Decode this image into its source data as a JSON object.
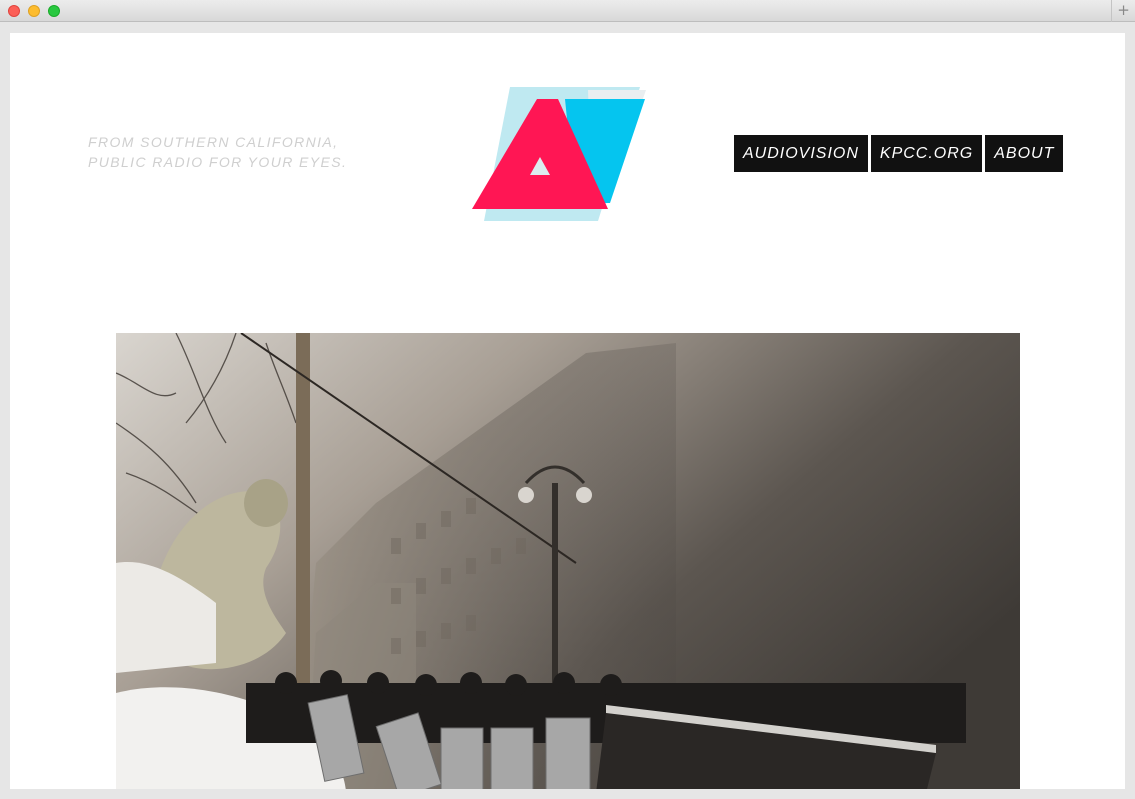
{
  "window": {
    "controls": [
      "close",
      "minimize",
      "zoom"
    ],
    "new_tab_label": "+"
  },
  "site": {
    "tagline": {
      "line1": "FROM SOUTHERN CALIFORNIA,",
      "line2": "PUBLIC RADIO FOR YOUR EYES."
    },
    "logo": {
      "letters": "AV",
      "colors": {
        "magenta": "#ff1654",
        "cyan": "#05c5ef",
        "shadow": "#bfe9f1"
      }
    },
    "nav": [
      {
        "label": "AUDIOVISION"
      },
      {
        "label": "KPCC.ORG"
      },
      {
        "label": "ABOUT"
      }
    ]
  },
  "hero": {
    "subject": "snowy street scene with riot police shields and statue"
  }
}
